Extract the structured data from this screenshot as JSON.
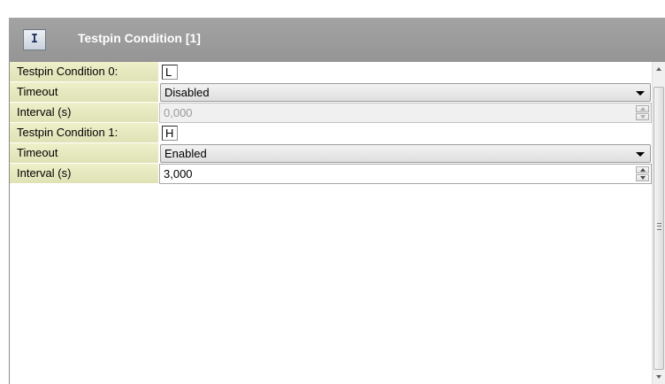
{
  "header": {
    "icon": "info-icon",
    "icon_glyph": "I",
    "title": "Testpin Condition [1]"
  },
  "rows": [
    {
      "label": "Testpin Condition 0:",
      "type": "text",
      "value": "L"
    },
    {
      "label": "Timeout",
      "type": "combo",
      "value": "Disabled"
    },
    {
      "label": "Interval (s)",
      "type": "spin",
      "value": "0,000",
      "disabled": true
    },
    {
      "label": "Testpin Condition 1:",
      "type": "text",
      "value": "H"
    },
    {
      "label": "Timeout",
      "type": "combo",
      "value": "Enabled"
    },
    {
      "label": "Interval (s)",
      "type": "spin",
      "value": "3,000",
      "disabled": false
    }
  ],
  "colors": {
    "header_bg": "#9c9c9c",
    "label_bg": "#e4e7bd",
    "disabled_text": "#9a9a9a"
  }
}
